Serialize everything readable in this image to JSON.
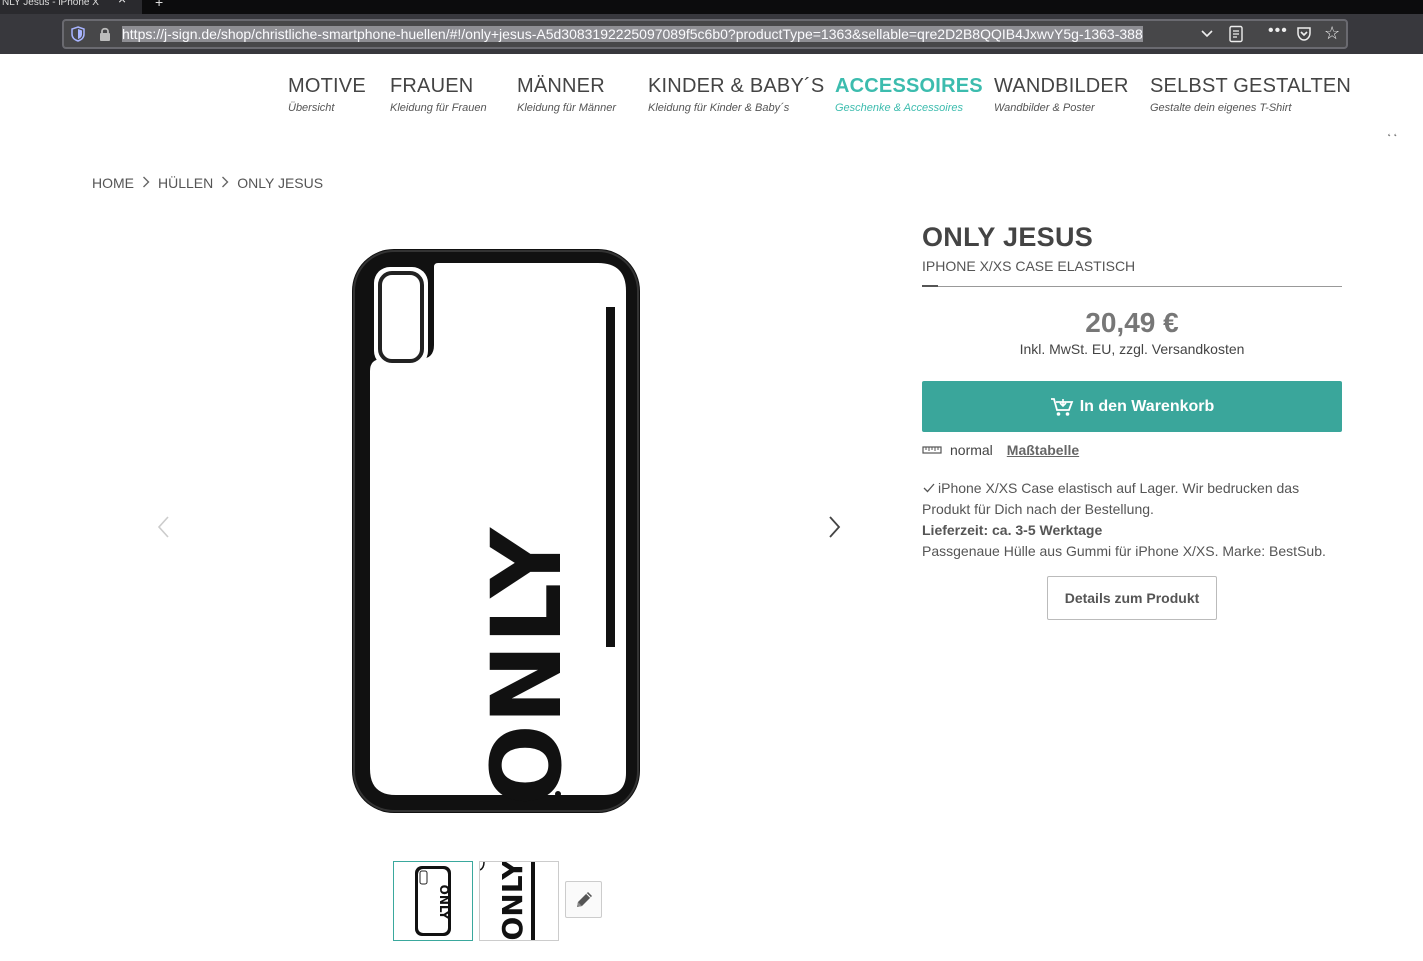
{
  "browser": {
    "tab_title": "NLY Jesus - iPhone X",
    "url": "https://j-sign.de/shop/christliche-smartphone-huellen/#!/only+jesus-A5d3083192225097089f5c6b0?productType=1363&sellable=qre2D2B8QQIB4JxwvY5g-1363-388"
  },
  "nav": {
    "items": [
      {
        "label": "MOTIVE",
        "sub": "Übersicht"
      },
      {
        "label": "FRAUEN",
        "sub": "Kleidung für Frauen"
      },
      {
        "label": "MÄNNER",
        "sub": "Kleidung für Männer"
      },
      {
        "label": "KINDER & BABY´S",
        "sub": "Kleidung für Kinder & Baby´s"
      },
      {
        "label": "ACCESSOIRES",
        "sub": "Geschenke & Accessoires"
      },
      {
        "label": "WANDBILDER",
        "sub": "Wandbilder & Poster"
      },
      {
        "label": "SELBST GESTALTEN",
        "sub": "Gestalte dein eigenes T-Shirt"
      }
    ],
    "active": "ACCESSOIRES"
  },
  "breadcrumb": [
    "HOME",
    "HÜLLEN",
    "ONLY JESUS"
  ],
  "product": {
    "title": "ONLY JESUS",
    "subtitle": "IPHONE X/XS CASE ELASTISCH",
    "price": "20,49 €",
    "tax_note": "Inkl. MwSt. EU, zzgl. Versandkosten",
    "cart_label": "In den Warenkorb",
    "size": "normal",
    "size_table_label": "Maßtabelle",
    "stock_note": "iPhone X/XS Case elastisch auf Lager. Wir bedrucken das Produkt für Dich nach der Bestellung.",
    "delivery": "Lieferzeit: ca. 3-5 Werktage",
    "description": "Passgenaue Hülle aus Gummi für iPhone X/XS. Marke: BestSub.",
    "details_label": "Details zum Produkt",
    "print_text": "ONLY"
  },
  "colors": {
    "accent": "#3cbcae",
    "button": "#3aa69b"
  }
}
